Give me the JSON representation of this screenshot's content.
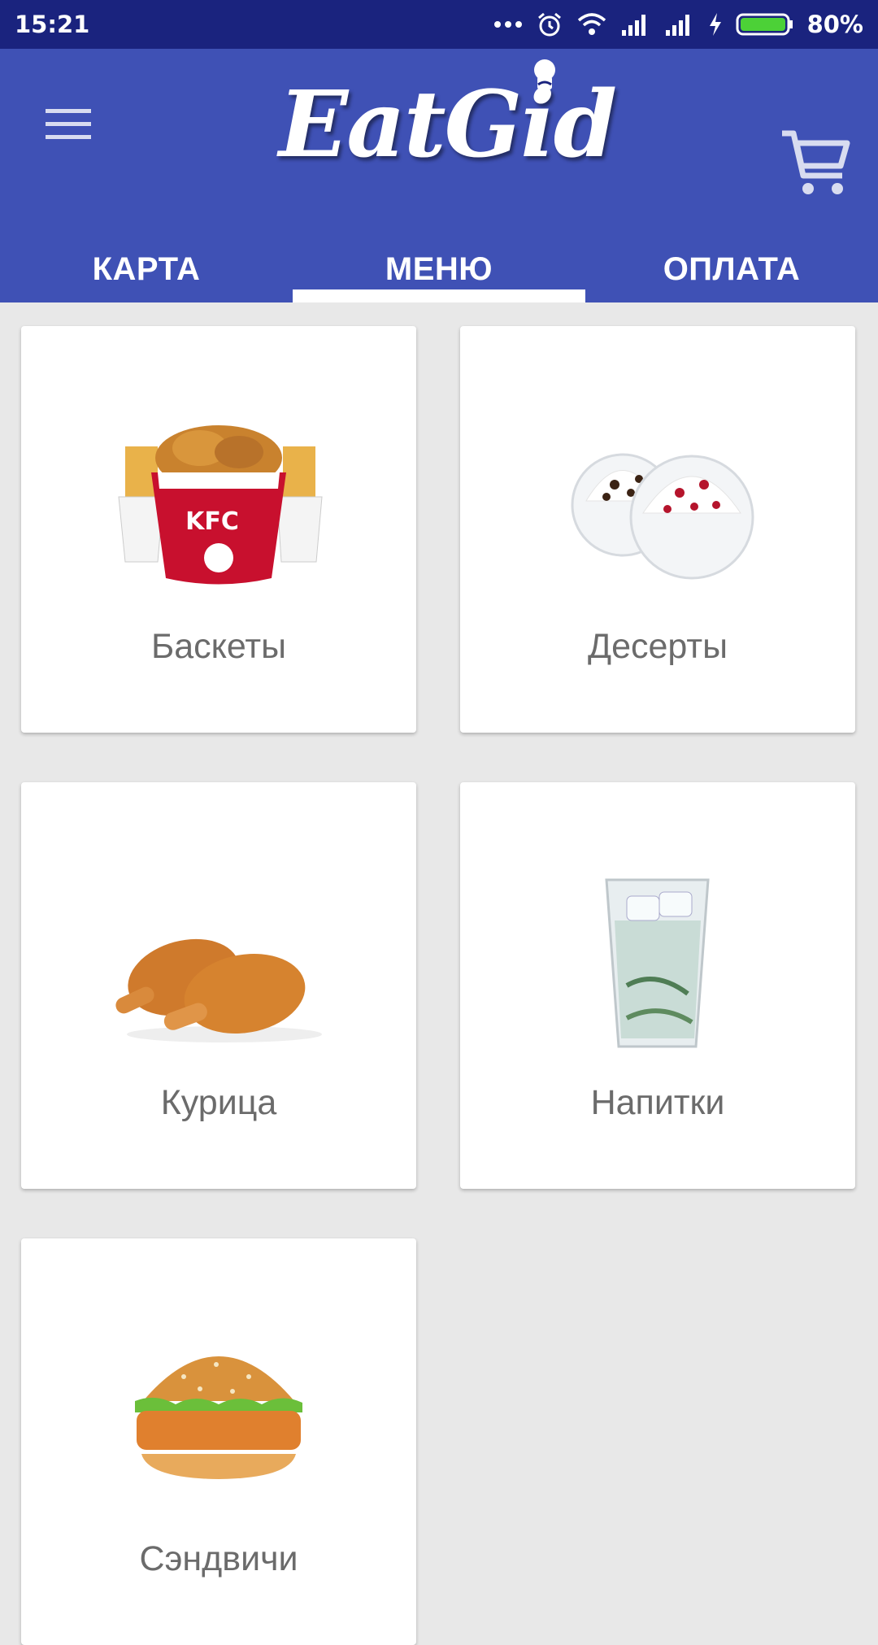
{
  "status_bar": {
    "time": "15:21",
    "battery": "80%"
  },
  "app_bar": {
    "logo_text": "EatGid",
    "tabs": [
      {
        "label": "КАРТА",
        "active": false
      },
      {
        "label": "МЕНЮ",
        "active": true
      },
      {
        "label": "ОПЛАТА",
        "active": false
      }
    ]
  },
  "menu": {
    "categories": [
      {
        "label": "Баскеты",
        "icon": "kfc-bucket-image"
      },
      {
        "label": "Десерты",
        "icon": "dessert-cups-image"
      },
      {
        "label": "Курица",
        "icon": "chicken-drumsticks-image"
      },
      {
        "label": "Напитки",
        "icon": "drink-cup-image"
      },
      {
        "label": "Сэндвичи",
        "icon": "burger-image"
      }
    ]
  },
  "colors": {
    "status_bar": "#1a237e",
    "app_bar": "#3f51b5",
    "background": "#e8e8e8"
  }
}
